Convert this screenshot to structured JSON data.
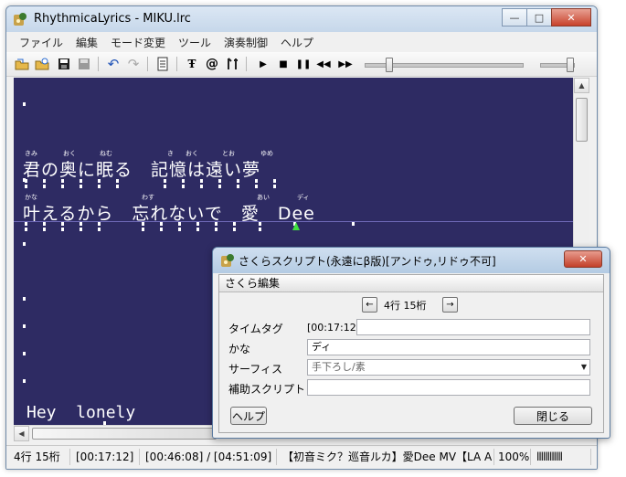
{
  "window": {
    "title": "RhythmicaLyrics - MIKU.lrc",
    "minimize": "—",
    "maximize": "□",
    "close": "✕"
  },
  "menu": [
    "ファイル",
    "編集",
    "モード変更",
    "ツール",
    "演奏制御",
    "ヘルプ"
  ],
  "toolbar": {
    "icons": [
      "open-folder-icon",
      "open-recent-icon",
      "save-icon",
      "save-as-icon",
      "undo-icon",
      "redo-icon",
      "document-icon",
      "font-icon",
      "at-sign-icon",
      "settings-icon",
      "play-icon",
      "stop-icon",
      "pause-icon",
      "rewind-icon",
      "fast-forward-icon"
    ],
    "position_slider": 0.15,
    "volume_slider": 0.9
  },
  "lyrics": {
    "line1": {
      "text": "君の奥に眠る　記憶は遠い夢",
      "ruby": [
        "きみ",
        "おく",
        "ねむ",
        "き",
        "おく",
        "とお",
        "ゆめ"
      ]
    },
    "line2": {
      "text": "叶えるから　忘れないで　愛　Dee",
      "ruby": [
        "かな",
        "わす",
        "あい",
        "ディ"
      ]
    },
    "line3": {
      "text": "Hey  lonely"
    }
  },
  "status": {
    "position": "4行 15桁",
    "time": "[00:17:12]",
    "elapsed_total": "[00:46:08] / [04:51:09]",
    "song": "【初音ミク？巡音ルカ】愛Dee MV【LA A",
    "zoom": "100%",
    "level": "llllllllllll"
  },
  "dialog": {
    "title": "さくらスクリプト(永遠にβ版)[アンドゥ,リドゥ不可]",
    "close": "✕",
    "group": "さくら編集",
    "prev": "←",
    "next": "→",
    "position": "4行 15桁",
    "labels": {
      "timetag": "タイムタグ",
      "kana": "かな",
      "surface": "サーフィス",
      "script": "補助スクリプト"
    },
    "timetag_value": "[00:17:12]",
    "kana_value": "ディ",
    "surface_value": "手下ろし/素",
    "help": "ヘルプ",
    "closebtn": "閉じる"
  }
}
